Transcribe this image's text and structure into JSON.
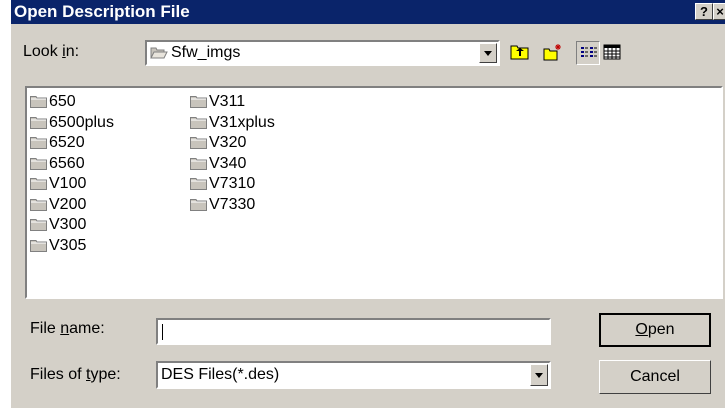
{
  "dialog": {
    "title": "Open Description File",
    "help_label": "?",
    "close_label": "×"
  },
  "look_in": {
    "label_pre": "Look ",
    "label_key": "i",
    "label_post": "n:",
    "value": "Sfw_imgs"
  },
  "toolbar": {
    "up_icon": "up-one-level-icon",
    "new_folder_icon": "create-new-folder-icon",
    "list_icon": "list-view-icon",
    "details_icon": "details-view-icon",
    "active_view": "list"
  },
  "files": [
    {
      "name": "650"
    },
    {
      "name": "6500plus"
    },
    {
      "name": "6520"
    },
    {
      "name": "6560"
    },
    {
      "name": "V100"
    },
    {
      "name": "V200"
    },
    {
      "name": "V300"
    },
    {
      "name": "V305"
    },
    {
      "name": "V311"
    },
    {
      "name": "V31xplus"
    },
    {
      "name": "V320"
    },
    {
      "name": "V340"
    },
    {
      "name": "V7310"
    },
    {
      "name": "V7330"
    }
  ],
  "file_name": {
    "label_pre": "File ",
    "label_key": "n",
    "label_post": "ame:",
    "value": ""
  },
  "file_type": {
    "label_pre": "Files of ",
    "label_key": "t",
    "label_post": "ype:",
    "value": "DES Files(*.des)"
  },
  "buttons": {
    "open_key": "O",
    "open_rest": "pen",
    "cancel": "Cancel"
  }
}
